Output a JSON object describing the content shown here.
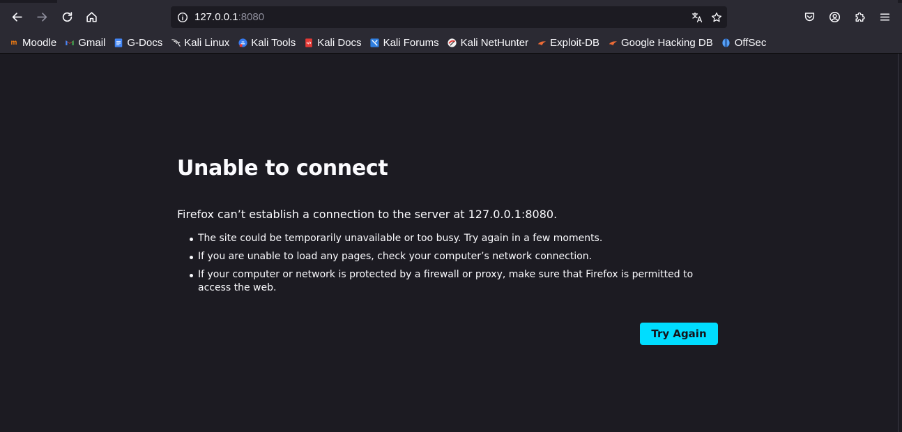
{
  "url": {
    "host": "127.0.0.1",
    "port": ":8080"
  },
  "navbar": {
    "back_icon": "arrow-left-icon",
    "forward_icon": "arrow-right-icon",
    "reload_icon": "reload-icon",
    "home_icon": "home-icon",
    "translate_icon": "translate-icon",
    "bookmark_star_icon": "star-icon",
    "pocket_icon": "pocket-icon",
    "account_icon": "account-icon",
    "extensions_icon": "puzzle-icon",
    "menu_icon": "hamburger-menu-icon"
  },
  "bookmarks": [
    {
      "label": "Moodle",
      "icon": "moodle-icon",
      "color": "#f98012"
    },
    {
      "label": "Gmail",
      "icon": "gmail-icon",
      "color": "#ea4335"
    },
    {
      "label": "G-Docs",
      "icon": "google-docs-icon",
      "color": "#4285f4"
    },
    {
      "label": "Kali Linux",
      "icon": "kali-dragon-icon",
      "color": "#ffffff"
    },
    {
      "label": "Kali Tools",
      "icon": "kali-tools-icon",
      "color": "#367bf0"
    },
    {
      "label": "Kali Docs",
      "icon": "kali-docs-icon",
      "color": "#e53935"
    },
    {
      "label": "Kali Forums",
      "icon": "kali-forums-icon",
      "color": "#2f7fe0"
    },
    {
      "label": "Kali NetHunter",
      "icon": "nethunter-icon",
      "color": "#e53935"
    },
    {
      "label": "Exploit-DB",
      "icon": "exploit-db-icon",
      "color": "#ec6b36"
    },
    {
      "label": "Google Hacking DB",
      "icon": "ghdb-icon",
      "color": "#ec6b36"
    },
    {
      "label": "OffSec",
      "icon": "offsec-icon",
      "color": "#3f8cf1"
    }
  ],
  "error": {
    "title": "Unable to connect",
    "lead": "Firefox can’t establish a connection to the server at 127.0.0.1:8080.",
    "items": [
      "The site could be temporarily unavailable or too busy. Try again in a few moments.",
      "If you are unable to load any pages, check your computer’s network connection.",
      "If your computer or network is protected by a firewall or proxy, make sure that Firefox is permitted to access the web."
    ],
    "button": "Try Again"
  },
  "colors": {
    "accent": "#00ddff",
    "page_bg": "#1c1b22",
    "toolbar_bg": "#2b2a33"
  }
}
